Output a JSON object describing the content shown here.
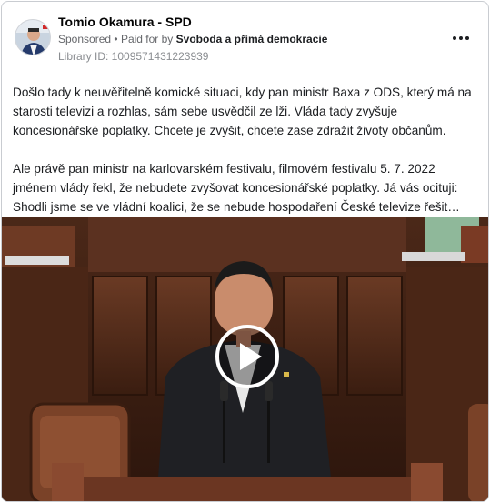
{
  "ad": {
    "page_name": "Tomio Okamura - SPD",
    "sponsored_label": "Sponsored",
    "paid_for_prefix": "Paid for by",
    "payer": "Svoboda a přímá demokracie",
    "library_id": "Library ID: 1009571431223939",
    "more_icon": "more-horizontal-icon"
  },
  "body": {
    "paragraph_1": "Došlo tady k neuvěřitelně komické situaci, kdy pan ministr Baxa z ODS, který má na starosti televizi a rozhlas, sám sebe usvědčil ze lži. Vláda tady zvyšuje koncesionářské poplatky. Chcete je zvýšit, chcete zase zdražit životy občanům.",
    "paragraph_2_line_1": "Ale právě pan ministr na karlovarském festivalu, filmovém festivalu 5. 7. 2022",
    "paragraph_2_line_2": "jménem vlády řekl, že nebudete zvyšovat koncesionářské poplatky. Já vás ocituji:",
    "paragraph_2_line_3": "Shodli jsme se ve vládní koalici, že se nebude hospodaření České televize řešit…"
  },
  "video": {
    "play_icon": "play-icon"
  },
  "colors": {
    "meta_grey": "#65676b",
    "border": "#c9ccd1",
    "video_wood": "#5a2e1c"
  }
}
